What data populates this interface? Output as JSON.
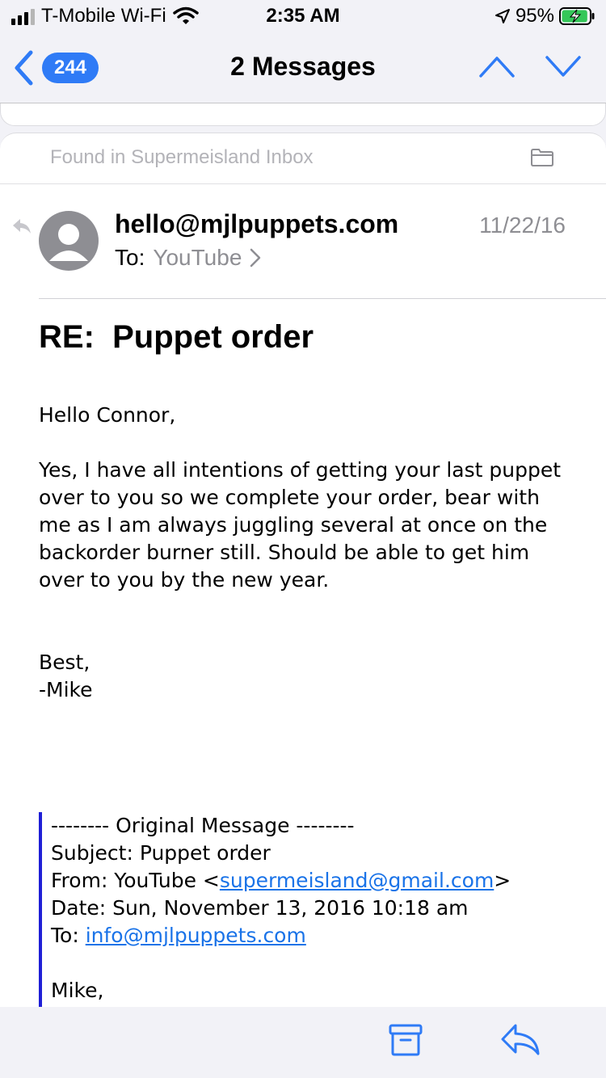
{
  "status_bar": {
    "carrier": "T-Mobile Wi-Fi",
    "time": "2:35 AM",
    "battery_percent": "95%",
    "battery_level": 0.95
  },
  "nav": {
    "unread_count": "244",
    "title": "2 Messages"
  },
  "found_in": "Found in Supermeisland Inbox",
  "message": {
    "sender": "hello@mjlpuppets.com",
    "date": "11/22/16",
    "to_label": "To:",
    "to_value": "YouTube",
    "subject": "RE:  Puppet order",
    "greeting": "Hello Connor,",
    "paragraph": "Yes, I have all intentions of getting your last puppet over to you so we complete your order, bear with me as I am always juggling several at once on the backorder burner still. Should be able to get him over to you by the new year.",
    "signoff_1": "Best,",
    "signoff_2": "-Mike"
  },
  "quoted": {
    "header": "-------- Original Message --------",
    "subject": "Subject: Puppet order",
    "from_prefix": "From: YouTube <",
    "from_email": "supermeisland@gmail.com",
    "from_suffix": ">",
    "date": "Date: Sun, November 13, 2016 10:18 am",
    "to_prefix": "To: ",
    "to_email": "info@mjlpuppets.com",
    "salutation": "Mike,"
  },
  "colors": {
    "accent": "#2f7bf6",
    "quote_bar": "#1f1fd6",
    "link": "#1a73e8"
  }
}
